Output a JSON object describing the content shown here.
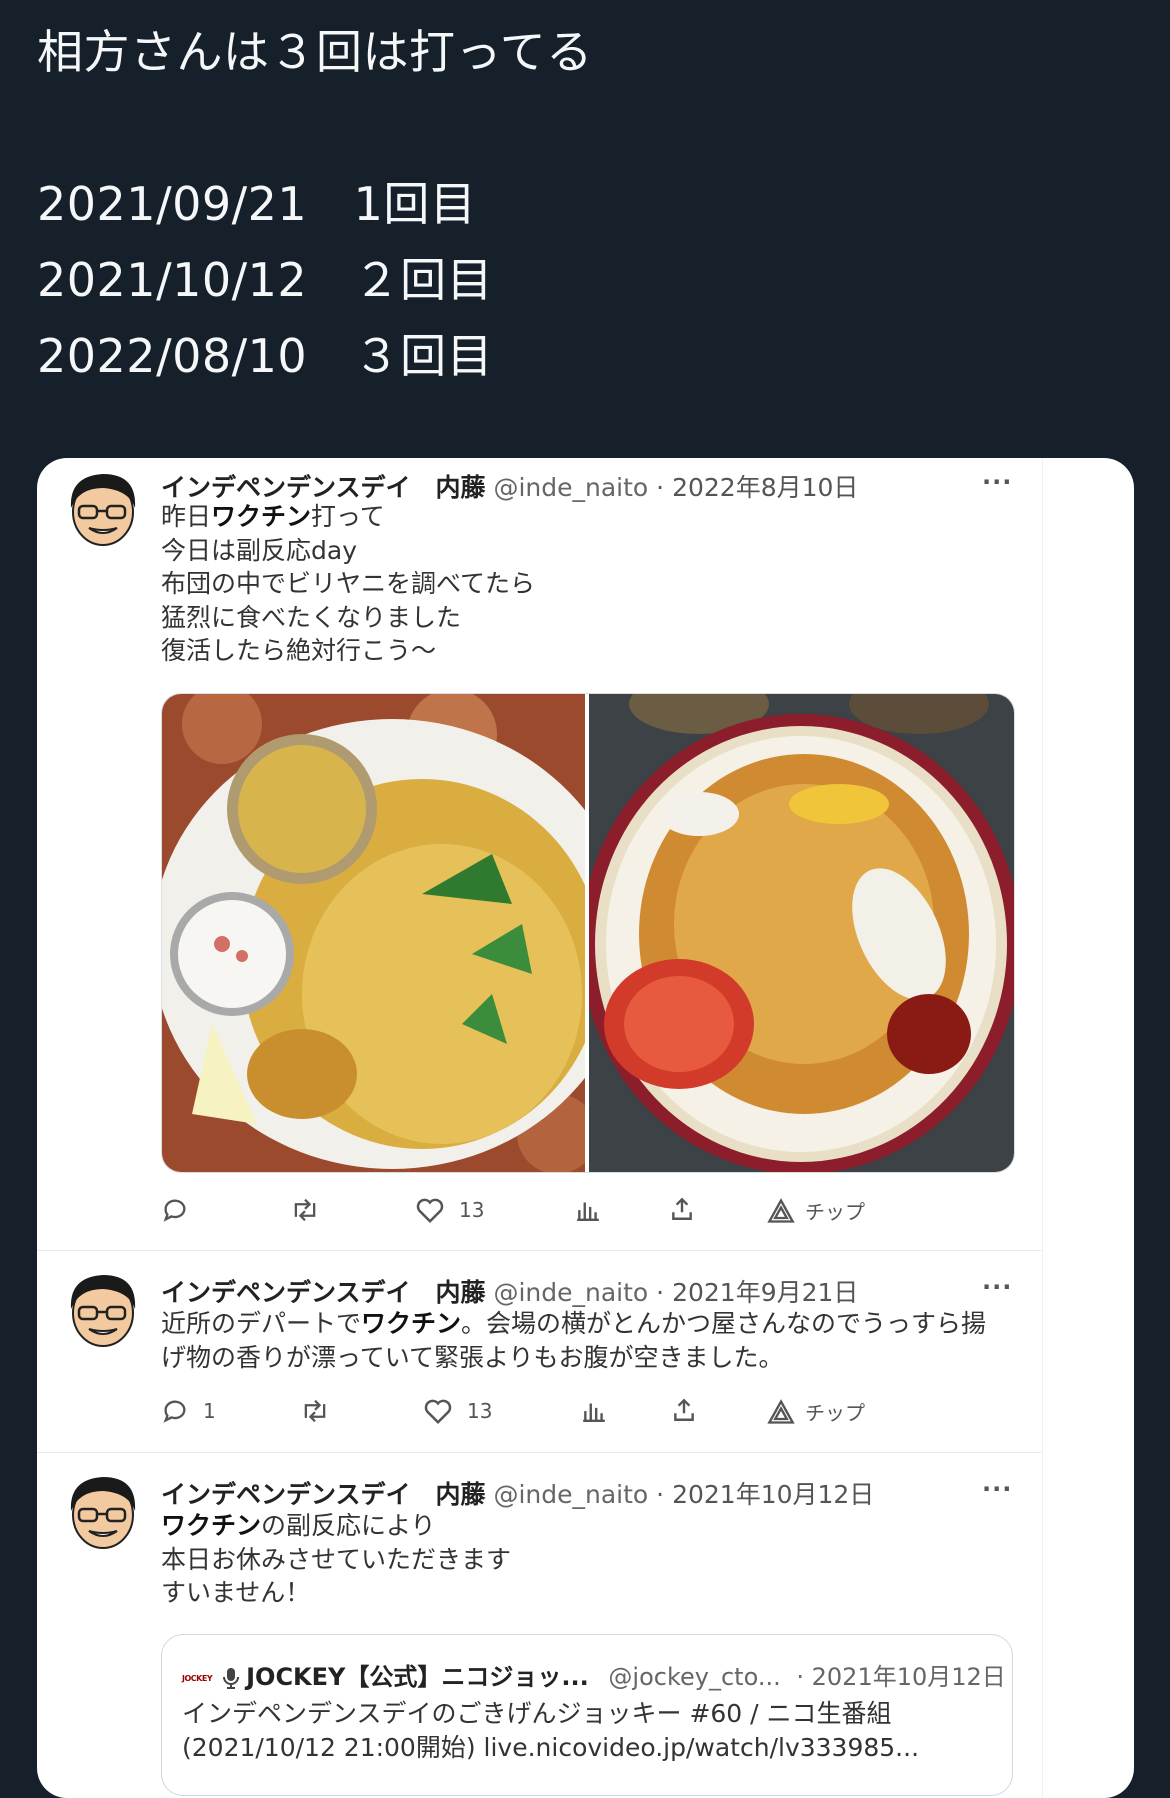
{
  "post": {
    "line1": "相方さんは３回は打ってる",
    "dates": [
      "2021/09/21　1回目",
      "2021/10/12　２回目",
      "2022/08/10　３回目"
    ]
  },
  "tweets": [
    {
      "name": "インデペンデンスデイ　内藤",
      "handle": "@inde_naito",
      "date": "· 2022年8月10日",
      "more": "···",
      "lines": [
        {
          "pre": "昨日",
          "bold": "ワクチン",
          "post": "打って"
        },
        {
          "pre": "今日は副反応day",
          "bold": "",
          "post": ""
        },
        {
          "pre": "布団の中でビリヤニを調べてたら",
          "bold": "",
          "post": ""
        },
        {
          "pre": "猛烈に食べたくなりました",
          "bold": "",
          "post": ""
        },
        {
          "pre": "復活したら絶対行こう～",
          "bold": "",
          "post": ""
        }
      ],
      "reply_count": "",
      "like_count": "13",
      "tip_label": "チップ"
    },
    {
      "name": "インデペンデンスデイ　内藤",
      "handle": "@inde_naito",
      "date": "· 2021年9月21日",
      "more": "···",
      "lines": [
        {
          "pre": "近所のデパートで",
          "bold": "ワクチン",
          "post": "。会場の横がとんかつ屋さんなのでうっすら揚"
        },
        {
          "pre": "げ物の香りが漂っていて緊張よりもお腹が空きました。",
          "bold": "",
          "post": ""
        }
      ],
      "reply_count": "1",
      "like_count": "13",
      "tip_label": "チップ"
    },
    {
      "name": "インデペンデンスデイ　内藤",
      "handle": "@inde_naito",
      "date": "· 2021年10月12日",
      "more": "···",
      "lines": [
        {
          "pre": "",
          "bold": "ワクチン",
          "post": "の副反応により"
        },
        {
          "pre": "本日お休みさせていただきます",
          "bold": "",
          "post": ""
        },
        {
          "pre": "すいません！",
          "bold": "",
          "post": ""
        }
      ]
    }
  ],
  "quote": {
    "logo": "JOCKEY",
    "name": "JOCKEY【公式】ニコジョッ...",
    "handle": "@jockey_cto...",
    "date": "· 2021年10月12日",
    "line1": "インデペンデンスデイのごきげんジョッキー #60 / ニコ生番組",
    "line2": "(2021/10/12 21:00開始) live.nicovideo.jp/watch/lv333985..."
  },
  "colors": {
    "background": "#15202b",
    "card": "#ffffff",
    "text_dark": "#222222"
  }
}
